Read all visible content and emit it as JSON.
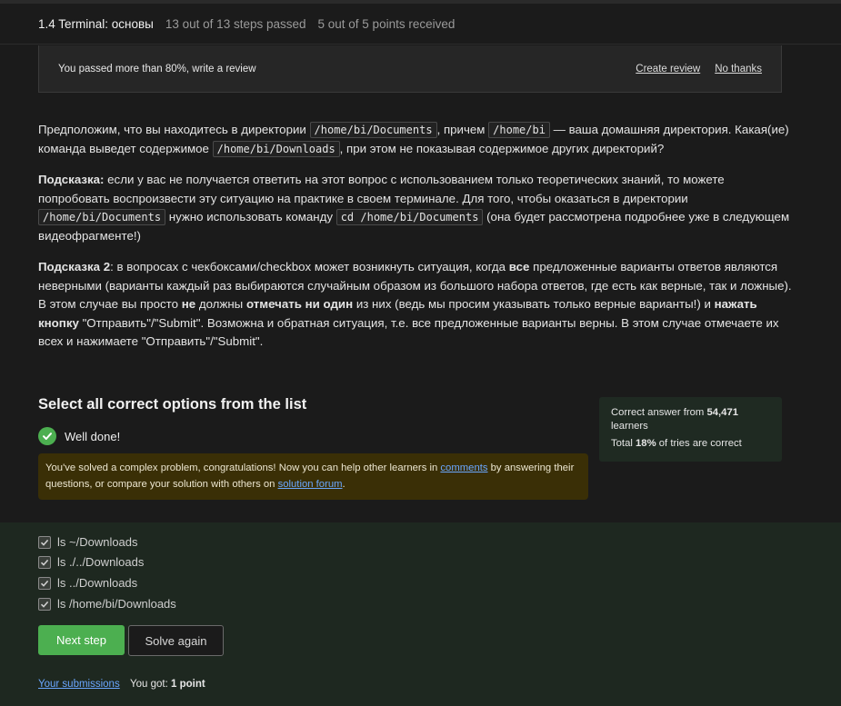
{
  "header": {
    "title": "1.4 Terminal: основы",
    "steps": "13 out of 13 steps passed",
    "points": "5 out of 5 points  received"
  },
  "review": {
    "message": "You passed more than 80%, write a review",
    "create": "Create review",
    "no_thanks": "No thanks"
  },
  "content": {
    "p1_t1": "Предположим, что вы находитесь в директории ",
    "p1_c1": "/home/bi/Documents",
    "p1_t2": ", причем ",
    "p1_c2": "/home/bi",
    "p1_t3": " — ваша домашняя директория. Какая(ие) команда выведет содержимое ",
    "p1_c3": "/home/bi/Downloads",
    "p1_t4": ", при этом не показывая содержимое других директорий?",
    "p2_b1": "Подсказка:",
    "p2_t1": " если у вас не получается ответить на этот вопрос с использованием только теоретических знаний, то можете попробовать воспроизвести эту ситуацию на практике в своем терминале. Для того, чтобы оказаться в директории ",
    "p2_c1": "/home/bi/Documents",
    "p2_t2": " нужно использовать команду ",
    "p2_c2": "cd /home/bi/Documents",
    "p2_t3": " (она будет рассмотрена подробнее уже в следующем видеофрагменте!)",
    "p3_b1": "Подсказка 2",
    "p3_t1": ": в вопросах с чекбоксами/checkbox может возникнуть ситуация, когда ",
    "p3_b2": "все",
    "p3_t2": " предложенные варианты ответов являются неверными (варианты каждый раз выбираются случайным образом из большого набора ответов, где есть как верные, так и ложные). В этом случае вы просто ",
    "p3_b3": "не",
    "p3_t3": " должны ",
    "p3_b4": "отмечать ни один",
    "p3_t4": " из них (ведь мы просим указывать только верные варианты!) и ",
    "p3_b5": "нажать кнопку",
    "p3_t5": " \"Отправить\"/\"Submit\". Возможна и обратная ситуация, т.е. все предложенные варианты верны. В этом случае отмечаете их всех и нажимаете \"Отправить\"/\"Submit\"."
  },
  "quiz": {
    "title": "Select all correct options from the list",
    "well_done": "Well done!",
    "congrats_t1": "You've solved a complex problem, congratulations! Now you can help other learners in ",
    "comments_link": "comments",
    "congrats_t2": " by answering their questions, or compare your solution with others on ",
    "forum_link": "solution forum",
    "congrats_t3": ".",
    "options": [
      {
        "label": "ls ~/Downloads",
        "checked": true
      },
      {
        "label": "ls ./../Downloads",
        "checked": true
      },
      {
        "label": "ls ../Downloads",
        "checked": true
      },
      {
        "label": "ls /home/bi/Downloads",
        "checked": true
      }
    ],
    "next_step": "Next step",
    "solve_again": "Solve again",
    "submissions": "Your submissions",
    "got_label": "You got: ",
    "got_value": "1 point"
  },
  "stats": {
    "correct_prefix": "Correct answer from ",
    "learners_count": "54,471",
    "learners_suffix": " learners",
    "total_prefix": "Total ",
    "percent": "18%",
    "total_suffix": " of tries are correct"
  },
  "colors": {
    "accent_green": "#4caf50",
    "link_blue": "#6aa7ff",
    "banner_yellow": "#3a2f06",
    "answers_bg": "#1e2820"
  },
  "icons": [
    "check-circle-icon",
    "checkbox-checked-icon"
  ]
}
